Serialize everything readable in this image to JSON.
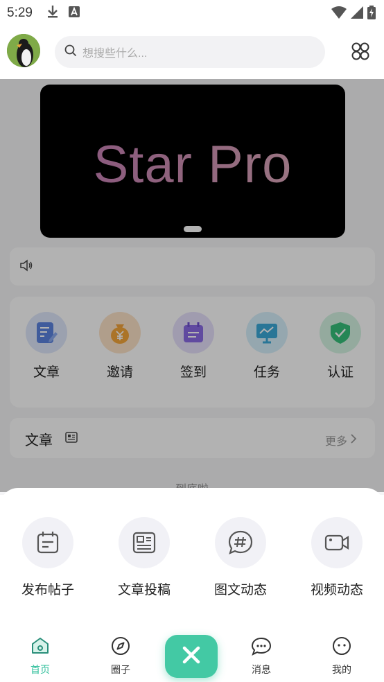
{
  "status_bar": {
    "time": "5:29"
  },
  "search": {
    "placeholder": "想搜些什么..."
  },
  "banner": {
    "title": "Star Pro"
  },
  "quick_actions": [
    {
      "label": "文章",
      "icon": "article-icon"
    },
    {
      "label": "邀请",
      "icon": "invite-money-bag-icon"
    },
    {
      "label": "签到",
      "icon": "sign-in-calendar-icon"
    },
    {
      "label": "任务",
      "icon": "task-monitor-icon"
    },
    {
      "label": "认证",
      "icon": "verify-shield-icon"
    }
  ],
  "section": {
    "title": "文章",
    "more": "更多"
  },
  "end_text": "—— 到底啦 ——",
  "sheet_actions": [
    {
      "label": "发布帖子",
      "icon": "post-calendar-icon"
    },
    {
      "label": "文章投稿",
      "icon": "article-submit-icon"
    },
    {
      "label": "图文动态",
      "icon": "hashtag-chat-icon"
    },
    {
      "label": "视频动态",
      "icon": "video-camera-icon"
    }
  ],
  "tabs": [
    {
      "label": "首页",
      "icon": "home-icon",
      "active": true
    },
    {
      "label": "圈子",
      "icon": "compass-icon",
      "active": false
    },
    {
      "label": "消息",
      "icon": "message-icon",
      "active": false
    },
    {
      "label": "我的",
      "icon": "profile-face-icon",
      "active": false
    }
  ],
  "colors": {
    "accent": "#43c9a4",
    "active_tab": "#2fbf9b"
  }
}
